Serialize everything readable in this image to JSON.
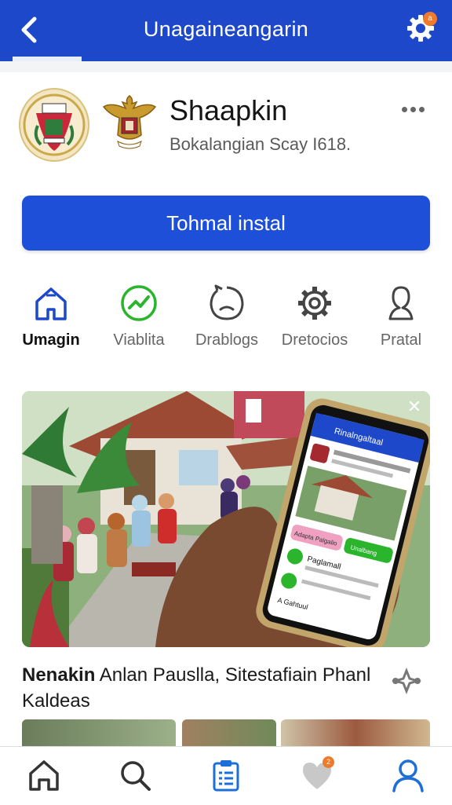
{
  "header": {
    "title": "Unagaineangarin",
    "settings_badge": "a"
  },
  "profile": {
    "name": "Shaapkin",
    "subtitle": "Bokalangian Scay I618."
  },
  "install_button": {
    "label": "Tohmal instal"
  },
  "categories": [
    {
      "label": "Umagin",
      "icon": "home-outline-icon",
      "active": true
    },
    {
      "label": "Viablita",
      "icon": "trend-icon",
      "active": false
    },
    {
      "label": "Drablogs",
      "icon": "chat-face-icon",
      "active": false
    },
    {
      "label": "Dretocios",
      "icon": "gear-icon",
      "active": false
    },
    {
      "label": "Pratal",
      "icon": "person-outline-icon",
      "active": false
    }
  ],
  "feature": {
    "phone_app_title": "Rinalngaltaal",
    "phone_button_1": "Adapta Palgalio",
    "phone_button_2": "Unalbang",
    "phone_card_title": "Paglamall",
    "phone_card_sub": "A Gahtuul"
  },
  "post": {
    "title_bold": "Nenakin",
    "title_rest": " Anlan Pauslla, Sitestafiain Phanl Kaldeas"
  },
  "bottom_nav": [
    {
      "name": "home",
      "icon": "home-icon"
    },
    {
      "name": "search",
      "icon": "search-icon"
    },
    {
      "name": "clipboard",
      "icon": "clipboard-icon"
    },
    {
      "name": "favorites",
      "icon": "heart-icon",
      "badge": "2"
    },
    {
      "name": "profile",
      "icon": "user-icon"
    }
  ],
  "colors": {
    "primary": "#1d48c9",
    "button": "#1e4fd8",
    "active_green": "#2bb52d",
    "badge": "#f07a2c"
  }
}
